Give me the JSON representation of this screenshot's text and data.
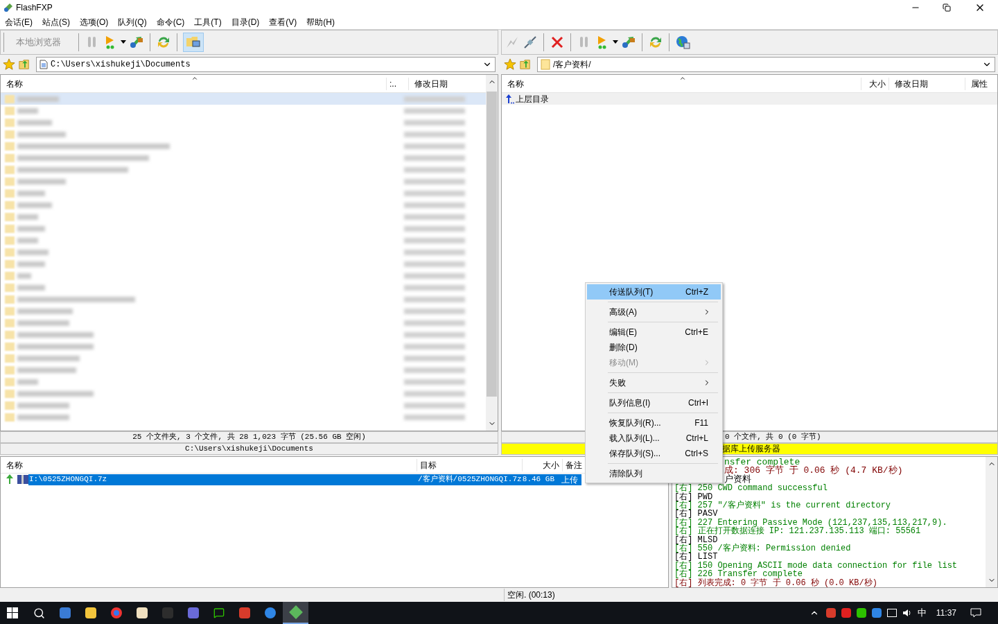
{
  "window": {
    "title": "FlashFXP"
  },
  "menu": [
    "会话(E)",
    "站点(S)",
    "选项(O)",
    "队列(Q)",
    "命令(C)",
    "工具(T)",
    "目录(D)",
    "查看(V)",
    "帮助(H)"
  ],
  "left_pane": {
    "toolbar_label": "本地浏览器",
    "path": "C:\\Users\\xishukeji\\Documents",
    "columns": [
      "名称",
      ":..",
      "修改日期"
    ],
    "rows": [
      {
        "kind": "blurred",
        "selected": true
      },
      {
        "kind": "blurred",
        "selected": false
      },
      {
        "kind": "blurred",
        "selected": false
      },
      {
        "kind": "blurred",
        "selected": false
      },
      {
        "kind": "blurred",
        "selected": false
      },
      {
        "kind": "blurred",
        "selected": false
      },
      {
        "kind": "blurred",
        "selected": false
      },
      {
        "kind": "blurred",
        "selected": false
      },
      {
        "kind": "blurred",
        "selected": false
      },
      {
        "kind": "blurred",
        "selected": false
      },
      {
        "kind": "blurred",
        "selected": false
      },
      {
        "kind": "blurred",
        "selected": false
      },
      {
        "kind": "blurred",
        "selected": false
      },
      {
        "kind": "blurred",
        "selected": false
      },
      {
        "kind": "blurred",
        "selected": false
      },
      {
        "kind": "blurred",
        "selected": false
      },
      {
        "kind": "blurred",
        "selected": false
      },
      {
        "kind": "blurred",
        "selected": false
      },
      {
        "kind": "blurred",
        "selected": false
      },
      {
        "kind": "blurred",
        "selected": false
      },
      {
        "kind": "blurred",
        "selected": false
      },
      {
        "kind": "blurred",
        "selected": false
      },
      {
        "kind": "blurred",
        "selected": false
      },
      {
        "kind": "blurred",
        "selected": false
      },
      {
        "kind": "blurred",
        "selected": false
      },
      {
        "kind": "blurred",
        "selected": false
      },
      {
        "kind": "blurred",
        "selected": false
      },
      {
        "kind": "blurred",
        "selected": false
      }
    ],
    "status": "25 个文件夹, 3 个文件, 共 28 1,023 字节 (25.56 GB 空闲)",
    "status_path": "C:\\Users\\xishukeji\\Documents"
  },
  "right_pane": {
    "path": "/客户资料/",
    "columns": [
      "名称",
      "大小",
      "修改日期",
      "属性"
    ],
    "rows": [
      {
        "name": "上层目录"
      }
    ],
    "status": "0 个文件, 共 0 (0 字节)",
    "banner": "据库上传服务器"
  },
  "queue": {
    "columns": [
      "名称",
      "目标",
      "大小",
      "备注"
    ],
    "rows": [
      {
        "name": "I:\\0525ZHONGQI.7z",
        "target": "/客户资料/0525ZHONGQI.7z",
        "size": "8.46 GB",
        "remark": "上传",
        "selected": true
      }
    ]
  },
  "log": [
    {
      "kind": "partial",
      "text": "nsfer complete",
      "color": "#008000"
    },
    {
      "kind": "partial",
      "text": "成: 306 字节 于 0.06 秒 (4.7 KB/秒)",
      "color": "#800000"
    },
    {
      "kind": "partial",
      "text": "户资料",
      "color": "#000000"
    },
    {
      "kind": "line",
      "prefix": "[右]",
      "text": "250 CWD command successful",
      "color": "#008000"
    },
    {
      "kind": "line",
      "prefix": "[右]",
      "text": "PWD",
      "color": "#000000"
    },
    {
      "kind": "line",
      "prefix": "[右]",
      "text": "257 \"/客户资料\" is the current directory",
      "color": "#008000"
    },
    {
      "kind": "line",
      "prefix": "[右]",
      "text": "PASV",
      "color": "#000000"
    },
    {
      "kind": "line",
      "prefix": "[右]",
      "text": "227 Entering Passive Mode (121,237,135,113,217,9).",
      "color": "#008000"
    },
    {
      "kind": "line",
      "prefix": "[右]",
      "text": "正在打开数据连接 IP: 121.237.135.113 端口: 55561",
      "color": "#008000"
    },
    {
      "kind": "line",
      "prefix": "[右]",
      "text": "MLSD",
      "color": "#000000"
    },
    {
      "kind": "line",
      "prefix": "[右]",
      "text": "550 /客户资料: Permission denied",
      "color": "#008000"
    },
    {
      "kind": "line",
      "prefix": "[右]",
      "text": "LIST",
      "color": "#000000"
    },
    {
      "kind": "line",
      "prefix": "[右]",
      "text": "150 Opening ASCII mode data connection for file list",
      "color": "#008000"
    },
    {
      "kind": "line",
      "prefix": "[右]",
      "text": "226 Transfer complete",
      "color": "#008000"
    },
    {
      "kind": "line",
      "prefix": "[右]",
      "text": "列表完成: 0 字节 于 0.06 秒 (0.0 KB/秒)",
      "color": "#800000"
    }
  ],
  "context_menu": [
    {
      "kind": "item",
      "label": "传送队列(T)",
      "shortcut": "Ctrl+Z",
      "selected": true,
      "disabled": false,
      "submenu": false
    },
    {
      "kind": "separator"
    },
    {
      "kind": "item",
      "label": "高级(A)",
      "selected": false,
      "disabled": false,
      "submenu": true
    },
    {
      "kind": "separator"
    },
    {
      "kind": "item",
      "label": "编辑(E)",
      "shortcut": "Ctrl+E",
      "selected": false,
      "disabled": false,
      "submenu": false
    },
    {
      "kind": "item",
      "label": "删除(D)",
      "selected": false,
      "disabled": false,
      "submenu": false
    },
    {
      "kind": "item",
      "label": "移动(M)",
      "selected": false,
      "disabled": true,
      "submenu": true
    },
    {
      "kind": "separator"
    },
    {
      "kind": "item",
      "label": "失败",
      "selected": false,
      "disabled": false,
      "submenu": true
    },
    {
      "kind": "separator"
    },
    {
      "kind": "item",
      "label": "队列信息(I)",
      "shortcut": "Ctrl+I",
      "selected": false,
      "disabled": false,
      "submenu": false
    },
    {
      "kind": "separator"
    },
    {
      "kind": "item",
      "label": "恢复队列(R)...",
      "shortcut": "F11",
      "selected": false,
      "disabled": false,
      "submenu": false
    },
    {
      "kind": "item",
      "label": "载入队列(L)...",
      "shortcut": "Ctrl+L",
      "selected": false,
      "disabled": false,
      "submenu": false
    },
    {
      "kind": "item",
      "label": "保存队列(S)...",
      "shortcut": "Ctrl+S",
      "selected": false,
      "disabled": false,
      "submenu": false
    },
    {
      "kind": "separator"
    },
    {
      "kind": "item",
      "label": "清除队列",
      "selected": false,
      "disabled": false,
      "submenu": false
    }
  ],
  "status_bar": "空闲. (00:13)",
  "taskbar": {
    "ime": "中",
    "clock": "11:37"
  }
}
